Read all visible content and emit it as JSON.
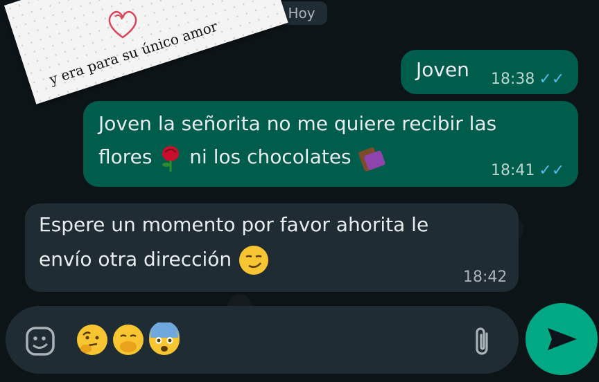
{
  "date_chip": "Hoy",
  "note_text": "y era para su único amor",
  "messages": [
    {
      "text": "Joven",
      "time": "18:38",
      "status": "read"
    },
    {
      "text_line1": "Joven la señorita no me quiere recibir las",
      "text_line2_a": "flores",
      "text_line2_b": "ni los chocolates",
      "time": "18:41",
      "status": "read"
    },
    {
      "text_line1": "Espere un momento por favor ahorita le",
      "text_line2": "envío otra dirección",
      "time": "18:42"
    }
  ],
  "composer": {
    "emojis": [
      "thinking-face",
      "face-with-hand-over-mouth",
      "fearful-face"
    ]
  },
  "colors": {
    "outgoing": "#005c4b",
    "incoming": "#202c33",
    "send": "#00a884",
    "tick": "#53bdeb"
  }
}
